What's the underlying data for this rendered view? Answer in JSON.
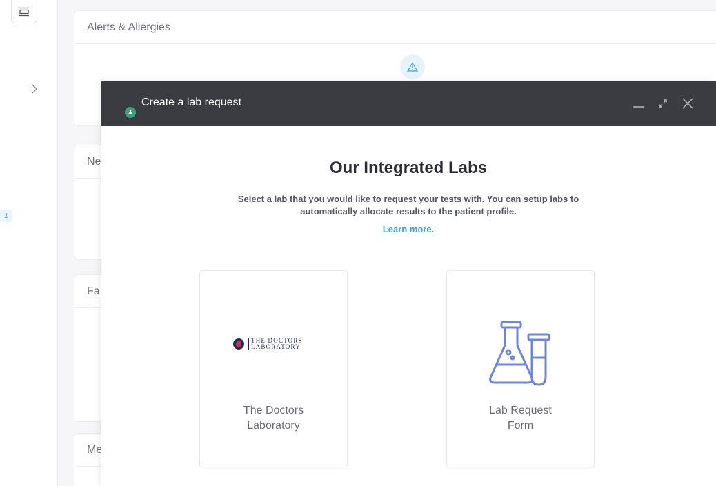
{
  "sidebar": {
    "badge_count": "1"
  },
  "background": {
    "cards": [
      {
        "title": "Alerts & Allergies"
      },
      {
        "title": "Ne"
      },
      {
        "title": "Fa"
      },
      {
        "title": "Me"
      }
    ]
  },
  "modal": {
    "title": "Create a lab request",
    "heading": "Our Integrated Labs",
    "description": "Select a lab that you would like to request your tests with. You can setup labs to automatically allocate results to the patient profile.",
    "learn_more": "Learn more.",
    "labs": [
      {
        "name": "The Doctors Laboratory",
        "logo_line1": "THE DOCTORS",
        "logo_line2": "LABORATORY",
        "icon": "doctors-laboratory-logo"
      },
      {
        "name": "Lab Request Form",
        "icon": "lab-flask-icon"
      }
    ]
  },
  "colors": {
    "header": "#3b3b42",
    "accent": "#3aa6d8",
    "flask": "#6e86d6",
    "app_icon": "#3e9e7c"
  }
}
